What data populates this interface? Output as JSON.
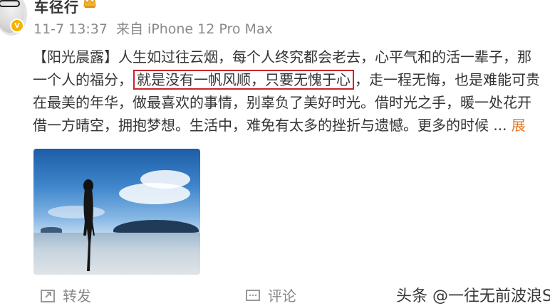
{
  "user": {
    "name": "车径行"
  },
  "meta": {
    "time": "11-7 13:37",
    "source_prefix": "来自",
    "device": "iPhone 12 Pro Max"
  },
  "post": {
    "line1": "【阳光晨露】人生如过往云烟，每个人终究都会老去，心平气和的活一辈子，那",
    "line2_before": "一个人的福分，",
    "line2_highlight": "就是没有一帆风顺，只要无愧于心",
    "line2_after": "，走一程无悔，也是难能可贵",
    "line3": "在最美的年华，做最喜欢的事情，别辜负了美好时光。借时光之手，暖一处花开",
    "line4": "借一方晴空，拥抱梦想。生活中，难免有太多的挫折与遗憾。更多的时候",
    "ellipsis": "...",
    "expand_label": "展"
  },
  "actions": {
    "repost": "转发",
    "comment": "评论"
  },
  "watermark": "头条 @一往无前波浪St",
  "colors": {
    "highlight_border": "#c8242b",
    "expand": "#e07a2c",
    "meta": "#8a8a8a"
  }
}
